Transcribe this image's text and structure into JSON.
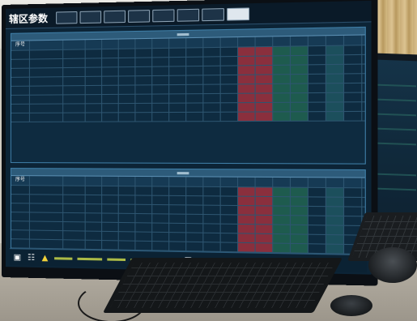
{
  "app": {
    "window_title": "辖区参数"
  },
  "toolbar": {
    "buttons": [
      {
        "name": "toolbar-button-1",
        "tone": "dark"
      },
      {
        "name": "toolbar-button-2",
        "tone": "dark"
      },
      {
        "name": "toolbar-button-3",
        "tone": "dark"
      },
      {
        "name": "toolbar-button-4",
        "tone": "dark"
      },
      {
        "name": "toolbar-button-5",
        "tone": "dark"
      },
      {
        "name": "toolbar-button-6",
        "tone": "dark"
      },
      {
        "name": "toolbar-button-7",
        "tone": "dark"
      },
      {
        "name": "toolbar-button-8",
        "tone": "light"
      }
    ]
  },
  "top_table": {
    "header": [
      "序号",
      "",
      "",
      "",
      "",
      "",
      "",
      "",
      "",
      "",
      "",
      "",
      "",
      "",
      "",
      "",
      "",
      "",
      "",
      ""
    ],
    "rows": [
      {
        "id": "",
        "values": [
          "",
          "",
          "",
          "",
          "",
          "",
          "",
          "",
          "",
          "",
          "",
          "",
          "",
          "",
          "",
          "",
          "",
          ""
        ]
      },
      {
        "id": "",
        "values": [
          "",
          "",
          "",
          "",
          "",
          "",
          "",
          "",
          "",
          "",
          "",
          "",
          "",
          "",
          "",
          "",
          "",
          ""
        ]
      },
      {
        "id": "",
        "values": [
          "",
          "",
          "",
          "",
          "",
          "",
          "",
          "",
          "",
          "",
          "",
          "",
          "",
          "",
          "",
          "",
          "",
          ""
        ]
      },
      {
        "id": "",
        "values": [
          "",
          "",
          "",
          "",
          "",
          "",
          "",
          "",
          "",
          "",
          "",
          "",
          "",
          "",
          "",
          "",
          "",
          ""
        ]
      },
      {
        "id": "",
        "values": [
          "",
          "",
          "",
          "",
          "",
          "",
          "",
          "",
          "",
          "",
          "",
          "",
          "",
          "",
          "",
          "",
          "",
          ""
        ]
      },
      {
        "id": "",
        "values": [
          "",
          "",
          "",
          "",
          "",
          "",
          "",
          "",
          "",
          "",
          "",
          "",
          "",
          "",
          "",
          "",
          "",
          ""
        ]
      },
      {
        "id": "",
        "values": [
          "",
          "",
          "",
          "",
          "",
          "",
          "",
          "",
          "",
          "",
          "",
          "",
          "",
          "",
          "",
          "",
          "",
          ""
        ]
      },
      {
        "id": "",
        "values": [
          "",
          "",
          "",
          "",
          "",
          "",
          "",
          "",
          "",
          "",
          "",
          "",
          "",
          "",
          "",
          "",
          "",
          ""
        ]
      }
    ]
  },
  "bottom_table": {
    "header": [
      "序号",
      "",
      "",
      "",
      "",
      "",
      "",
      "",
      "",
      "",
      "",
      "",
      "",
      "",
      "",
      "",
      "",
      "",
      "",
      ""
    ],
    "rows": [
      {
        "id": "",
        "values": [
          "",
          "",
          "",
          "",
          "",
          "",
          "",
          "",
          "",
          "",
          "",
          "",
          "",
          "",
          "",
          "",
          "",
          ""
        ]
      },
      {
        "id": "",
        "values": [
          "",
          "",
          "",
          "",
          "",
          "",
          "",
          "",
          "",
          "",
          "",
          "",
          "",
          "",
          "",
          "",
          "",
          ""
        ]
      },
      {
        "id": "",
        "values": [
          "",
          "",
          "",
          "",
          "",
          "",
          "",
          "",
          "",
          "",
          "",
          "",
          "",
          "",
          "",
          "",
          "",
          ""
        ]
      },
      {
        "id": "",
        "values": [
          "",
          "",
          "",
          "",
          "",
          "",
          "",
          "",
          "",
          "",
          "",
          "",
          "",
          "",
          "",
          "",
          "",
          ""
        ]
      },
      {
        "id": "",
        "values": [
          "",
          "",
          "",
          "",
          "",
          "",
          "",
          "",
          "",
          "",
          "",
          "",
          "",
          "",
          "",
          "",
          "",
          ""
        ]
      },
      {
        "id": "",
        "values": [
          "",
          "",
          "",
          "",
          "",
          "",
          "",
          "",
          "",
          "",
          "",
          "",
          "",
          "",
          "",
          "",
          "",
          ""
        ]
      },
      {
        "id": "",
        "values": [
          "",
          "",
          "",
          "",
          "",
          "",
          "",
          "",
          "",
          "",
          "",
          "",
          "",
          "",
          "",
          "",
          "",
          ""
        ]
      }
    ]
  },
  "status_bar": {
    "icons": [
      "start-icon",
      "network-icon",
      "warning-icon"
    ]
  },
  "colors": {
    "screen_bg": "#0c2436",
    "grid_line": "#2d5570",
    "alarm_cell": "#8a2f3d",
    "ok_cell": "#1e5b4e",
    "value_text": "#9be8c9"
  }
}
